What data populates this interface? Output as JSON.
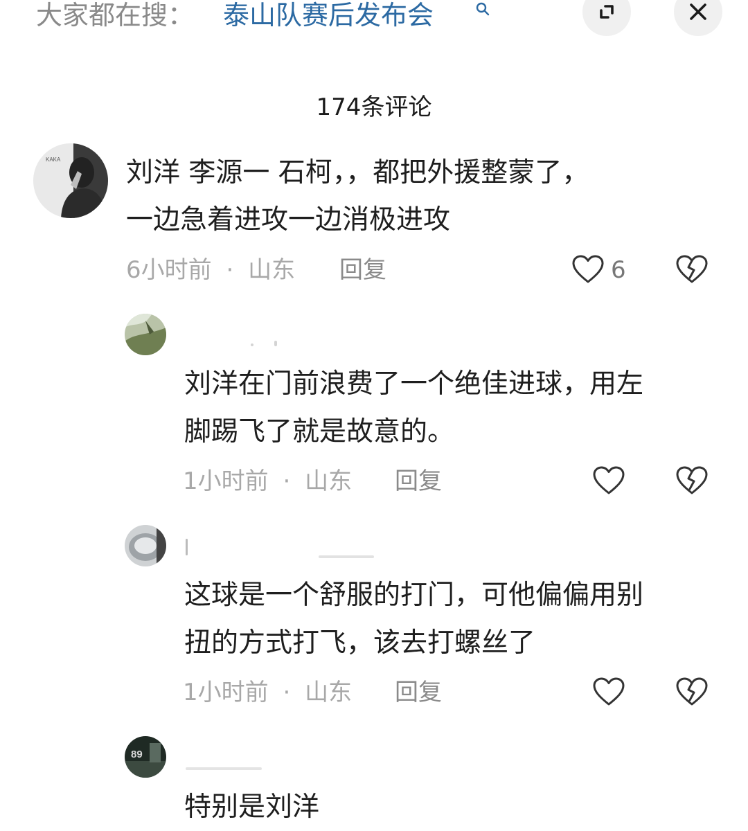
{
  "search_bar": {
    "prefix": "大家都在搜：",
    "term": "泰山队赛后发布会",
    "search_icon": "search-icon",
    "expand_icon": "expand-icon",
    "close_icon": "close-icon"
  },
  "header": {
    "comment_count": "174条评论"
  },
  "comments": [
    {
      "lines": [
        "刘洋  李源一  石柯，，都把外援整蒙了，",
        "一边急着进攻一边消极进攻"
      ],
      "time": "6小时前",
      "location": "山东",
      "separator": "·",
      "reply": "回复",
      "like_count": "6"
    },
    {
      "lines": [
        "刘洋在门前浪费了一个绝佳进球，用左",
        "脚踢飞了就是故意的。"
      ],
      "time": "1小时前",
      "location": "山东",
      "separator": "·",
      "reply": "回复"
    },
    {
      "lines": [
        "这球是一个舒服的打门，可他偏偏用别",
        "扭的方式打飞，该去打螺丝了"
      ],
      "time": "1小时前",
      "location": "山东",
      "separator": "·",
      "reply": "回复"
    },
    {
      "lines": [
        "特别是刘洋"
      ]
    }
  ],
  "avatars": {
    "first_badge": "KAKA",
    "last_badge": "89"
  },
  "colors": {
    "search_term": "#2c6aa3",
    "muted_text": "#a8a8a8",
    "body_text": "#1e1e1e",
    "button_bg": "#f0f0f0"
  }
}
